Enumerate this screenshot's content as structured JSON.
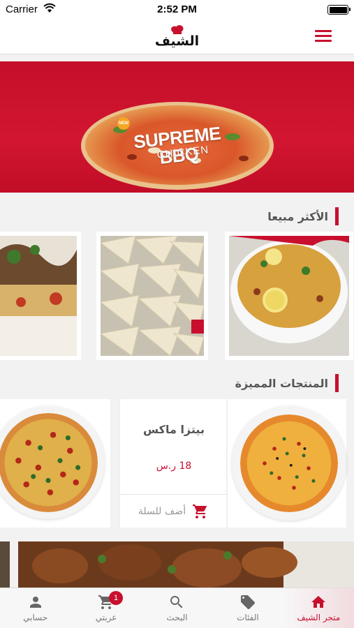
{
  "status_bar": {
    "carrier": "Carrier",
    "time": "2:52 PM"
  },
  "header": {
    "logo_text": "الشيف"
  },
  "banner": {
    "new_badge": "NEW",
    "title": "SUPREME BBQ",
    "subtitle": "CHICKEN"
  },
  "best_sellers": {
    "title": "الأكثر مبيعا"
  },
  "featured": {
    "title": "المنتجات المميزة",
    "product": {
      "name": "بيتزا ماكس",
      "price": "18 ر.س",
      "add_to_cart": "أضف للسلة"
    }
  },
  "tabs": [
    {
      "label": "متجر الشيف",
      "icon": "home-icon",
      "active": true
    },
    {
      "label": "الفئات",
      "icon": "tag-icon",
      "active": false
    },
    {
      "label": "البحث",
      "icon": "search-icon",
      "active": false
    },
    {
      "label": "عربتي",
      "icon": "cart-icon",
      "active": false,
      "badge": "1"
    },
    {
      "label": "حسابي",
      "icon": "person-icon",
      "active": false
    }
  ],
  "colors": {
    "accent": "#c8102e",
    "banner": "#c50f2a"
  }
}
